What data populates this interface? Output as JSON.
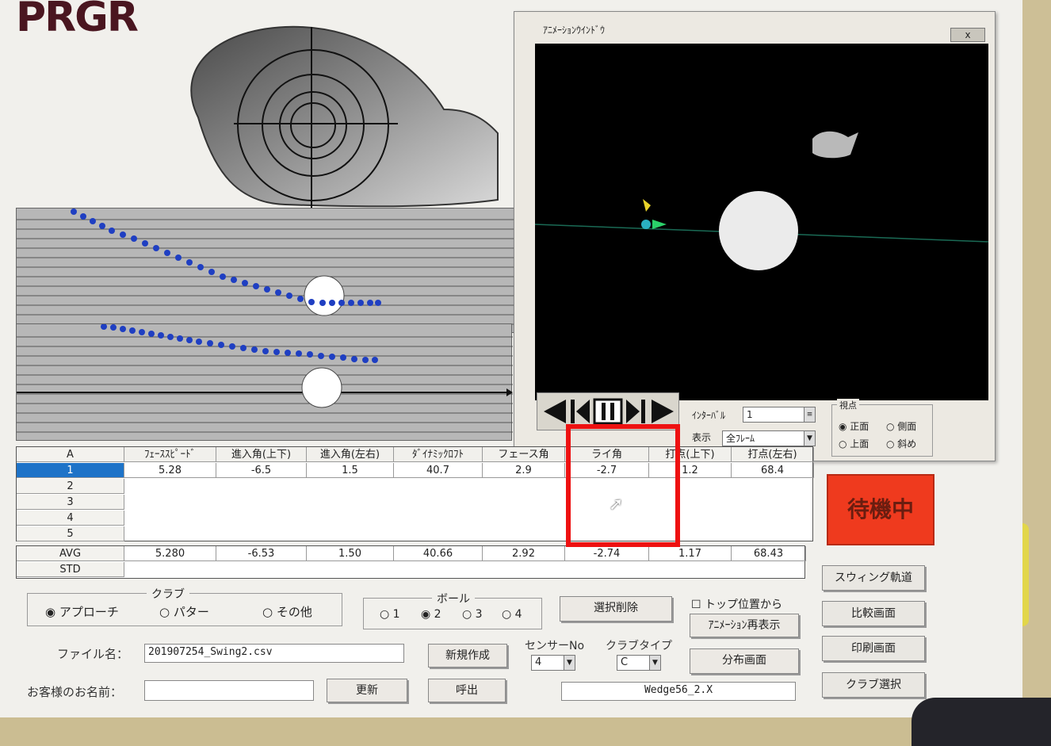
{
  "logo": "PRGR",
  "animation_window": {
    "title": "ｱﾆﾒｰｼｮﾝｳｲﾝﾄﾞｳ",
    "close_label": "x",
    "interval_label": "ｲﾝﾀｰﾊﾞﾙ",
    "interval_value": "1",
    "display_label": "表示",
    "display_value": "全ﾌﾚｰﾑ",
    "viewpoint_label": "視点",
    "viewpoints": [
      "正面",
      "側面",
      "上面",
      "斜め"
    ],
    "viewpoint_selected": "正面"
  },
  "grid": {
    "corner": "A",
    "headers": [
      "ﾌｪｰｽｽﾋﾟｰﾄﾞ",
      "進入角(上下)",
      "進入角(左右)",
      "ﾀﾞｲﾅﾐｯｸﾛﾌﾄ",
      "フェース角",
      "ライ角",
      "打点(上下)",
      "打点(左右)"
    ],
    "row_labels": [
      "1",
      "2",
      "3",
      "4",
      "5"
    ],
    "rows": [
      [
        "5.28",
        "-6.5",
        "1.5",
        "40.7",
        "2.9",
        "-2.7",
        "1.2",
        "68.4"
      ]
    ],
    "stats": [
      {
        "label": "AVG",
        "values": [
          "5.280",
          "-6.53",
          "1.50",
          "40.66",
          "2.92",
          "-2.74",
          "1.17",
          "68.43"
        ]
      },
      {
        "label": "STD",
        "values": [
          "",
          "",
          "",
          "",
          "",
          "",
          "",
          ""
        ]
      }
    ]
  },
  "status": "待機中",
  "side_buttons": [
    "スウィング軌道",
    "比較画面",
    "印刷画面",
    "クラブ選択"
  ],
  "club_group": {
    "legend": "クラブ",
    "options": [
      "アプローチ",
      "パター",
      "その他"
    ],
    "selected": "アプローチ"
  },
  "ball_group": {
    "legend": "ボール",
    "options": [
      "1",
      "2",
      "3",
      "4"
    ],
    "selected": "2"
  },
  "buttons": {
    "delete_selected": "選択削除",
    "top_position": "トップ位置から",
    "anim_redisplay": "ｱﾆﾒｰｼｮﾝ再表示",
    "distribution": "分布画面",
    "new_file": "新規作成",
    "update": "更新",
    "call": "呼出"
  },
  "file": {
    "label": "ファイル名：",
    "value": "201907254_Swing2.csv"
  },
  "customer": {
    "label": "お客様のお名前：",
    "value": ""
  },
  "sensor": {
    "label": "センサーNo",
    "value": "4"
  },
  "club_type": {
    "label": "クラブタイプ",
    "value": "C"
  },
  "club_file": "Wedge56_2.X"
}
